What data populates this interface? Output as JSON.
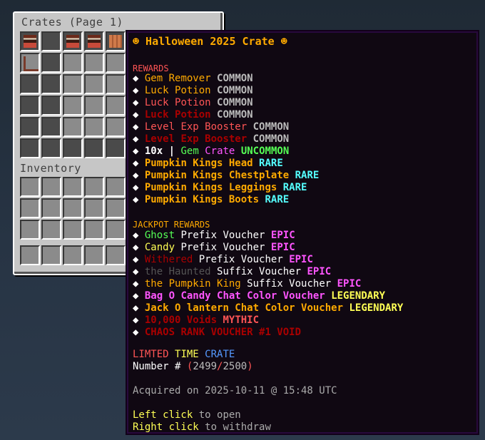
{
  "inventory": {
    "crates_title": "Crates (Page 1)",
    "inventory_title": "Inventory"
  },
  "tooltip": {
    "title": "☻ Halloween 2025 Crate ☻",
    "rewards_header": "REWARDS",
    "rewards": [
      {
        "bullet": "◆",
        "name": "Gem Remover",
        "rarity": "COMMON"
      },
      {
        "bullet": "◆",
        "name": "Luck Potion",
        "rarity": "COMMON"
      },
      {
        "bullet": "◆",
        "name": "Luck Potion",
        "rarity": "COMMON"
      },
      {
        "bullet": "◆",
        "name": "Luck Potion",
        "rarity": "COMMON"
      },
      {
        "bullet": "◆",
        "name": "Level Exp Booster",
        "rarity": "COMMON"
      },
      {
        "bullet": "◆",
        "name": "Level Exp Booster",
        "rarity": "COMMON"
      },
      {
        "bullet": "◆",
        "qty": "10x",
        "sep": "|",
        "gem": "Gem",
        "crate": "Crate",
        "rarity": "UNCOMMON"
      },
      {
        "bullet": "◆",
        "name": "Pumpkin Kings Head",
        "rarity": "RARE"
      },
      {
        "bullet": "◆",
        "name": "Pumpkin Kings Chestplate",
        "rarity": "RARE"
      },
      {
        "bullet": "◆",
        "name": "Pumpkin Kings Leggings",
        "rarity": "RARE"
      },
      {
        "bullet": "◆",
        "name": "Pumpkin Kings Boots",
        "rarity": "RARE"
      }
    ],
    "jackpot_header": "JACKPOT REWARDS",
    "jackpot": [
      {
        "bullet": "◆",
        "a": "Ghost",
        "b": "Prefix Voucher",
        "rarity": "EPIC"
      },
      {
        "bullet": "◆",
        "a": "Candy",
        "b": "Prefix Voucher",
        "rarity": "EPIC"
      },
      {
        "bullet": "◆",
        "a": "Withered",
        "b": "Prefix Voucher",
        "rarity": "EPIC"
      },
      {
        "bullet": "◆",
        "a": "the Haunted",
        "b": "Suffix Voucher",
        "rarity": "EPIC"
      },
      {
        "bullet": "◆",
        "a": "the Pumpkin King",
        "b": "Suffix Voucher",
        "rarity": "EPIC"
      },
      {
        "bullet": "◆",
        "a": "Bag O Candy Chat Color Voucher",
        "rarity": "LEGENDARY"
      },
      {
        "bullet": "◆",
        "a": "Jack O lantern Chat Color Voucher",
        "rarity": "LEGENDARY"
      },
      {
        "bullet": "◆",
        "a": "10,000 Voids",
        "rarity": "MYTHIC"
      },
      {
        "bullet": "◆",
        "a": "CHAOS RANK VOUCHER #1 VOID",
        "rarity": ""
      }
    ],
    "limited_a": "LIMTED",
    "limited_b": "TIME",
    "limited_c": "CRATE",
    "number_label": "Number #",
    "number_open": "(",
    "number_val": "2499",
    "number_sep": "/",
    "number_total": "2500",
    "number_close": ")",
    "acquired": "Acquired on 2025-10-11 @ 15:48 UTC",
    "left_click": "Left click",
    "left_action": "to open",
    "right_click": "Right click",
    "right_action": "to withdraw"
  },
  "colors": {
    "panel": "#c6c6c6",
    "slot": "#8b8b8b",
    "tooltip_bg": "#100812",
    "tooltip_border": "#28093c"
  }
}
